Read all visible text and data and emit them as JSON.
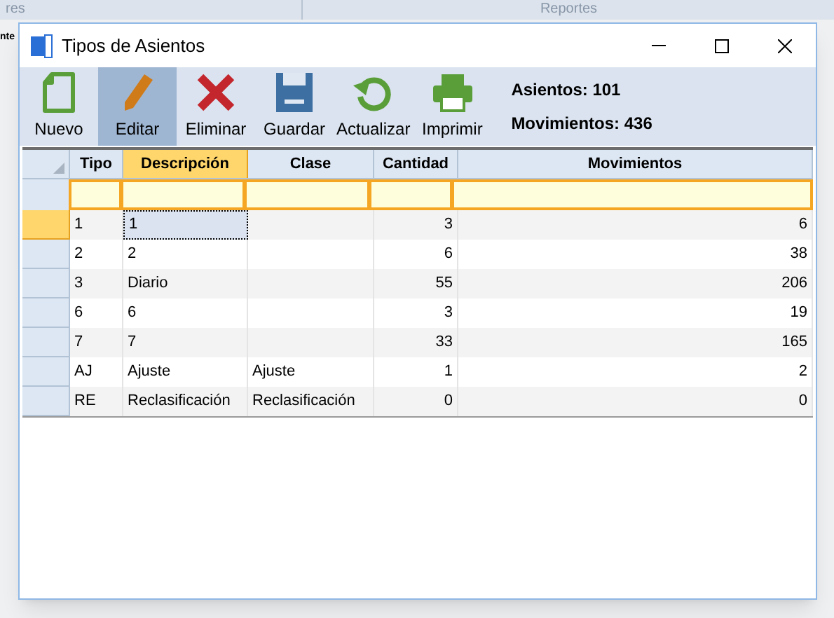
{
  "background": {
    "tabs": [
      "res",
      "Reportes"
    ],
    "side_text": "nte"
  },
  "window": {
    "title": "Tipos de Asientos"
  },
  "toolbar": {
    "buttons": [
      {
        "kind": "new",
        "label": "Nuevo",
        "selected": false
      },
      {
        "kind": "edit",
        "label": "Editar",
        "selected": true
      },
      {
        "kind": "delete",
        "label": "Eliminar",
        "selected": false
      },
      {
        "kind": "save",
        "label": "Guardar",
        "selected": false
      },
      {
        "kind": "refresh",
        "label": "Actualizar",
        "selected": false
      },
      {
        "kind": "print",
        "label": "Imprimir",
        "selected": false
      }
    ],
    "stats": [
      "Asientos: 101",
      "Movimientos: 436"
    ]
  },
  "table": {
    "columns": [
      {
        "label": "Tipo",
        "selected": false
      },
      {
        "label": "Descripción",
        "selected": true
      },
      {
        "label": "Clase",
        "selected": false
      },
      {
        "label": "Cantidad",
        "selected": false
      },
      {
        "label": "Movimientos",
        "selected": false
      }
    ],
    "rows": [
      {
        "cells": [
          "1",
          "1",
          "",
          "3",
          "6"
        ],
        "selected": true
      },
      {
        "cells": [
          "2",
          "2",
          "",
          "6",
          "38"
        ],
        "selected": false
      },
      {
        "cells": [
          "3",
          "Diario",
          "",
          "55",
          "206"
        ],
        "selected": false
      },
      {
        "cells": [
          "6",
          "6",
          "",
          "3",
          "19"
        ],
        "selected": false
      },
      {
        "cells": [
          "7",
          "7",
          "",
          "33",
          "165"
        ],
        "selected": false
      },
      {
        "cells": [
          "AJ",
          "Ajuste",
          "Ajuste",
          "1",
          "2"
        ],
        "selected": false
      },
      {
        "cells": [
          "RE",
          "Reclasificación",
          "Reclasificación",
          "0",
          "0"
        ],
        "selected": false
      }
    ]
  }
}
